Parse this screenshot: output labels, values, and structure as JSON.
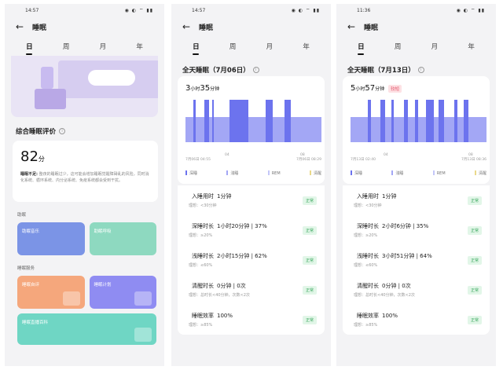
{
  "colors": {
    "deep": "#6c73ee",
    "light": "#a3a7f5",
    "rem": "#c4c7f8",
    "awake": "#ead98a",
    "normal": "#3aa75e"
  },
  "phone1": {
    "time": "14:57",
    "title": "睡眠",
    "tabs": [
      "日",
      "周",
      "月",
      "年"
    ],
    "section_title": "综合睡眠评价",
    "score": "82",
    "score_unit": "分",
    "score_label": "睡眠不足:",
    "score_desc": "整夜的睡眠过少，这可能会增加睡眠觉醒障碍乱的风险，同时消化系统、循环系统、内分泌系统、免疫系统都会受到干扰。",
    "group1_label": "助眠",
    "tile_music": "助眠音乐",
    "tile_breath": "助眠呼吸",
    "group2_label": "睡眠服务",
    "tile_quiz": "睡眠自评",
    "tile_plan": "睡眠计划",
    "tile_knowledge": "睡眠直播百科"
  },
  "phone2": {
    "time": "14:57",
    "title": "睡眠",
    "tabs": [
      "日",
      "周",
      "月",
      "年"
    ],
    "day_title": "全天睡眠（7月06日）",
    "dur_h": "3",
    "dur_h_unit": "小时",
    "dur_m": "35",
    "dur_m_unit": "分钟",
    "start": "7月06日 04:55",
    "end": "7月06日 08:29",
    "tick1": "04",
    "tick2": "08",
    "legend": [
      "深睡",
      "浅睡",
      "REM",
      "清醒"
    ],
    "metrics": [
      {
        "name": "入睡用时",
        "value": "1分钟",
        "ref": "理想：<30分钟",
        "status": "正常"
      },
      {
        "name": "深睡时长",
        "value": "1小时20分钟 | 37%",
        "ref": "理想：≥20%",
        "status": "正常"
      },
      {
        "name": "浅睡时长",
        "value": "2小时15分钟 | 62%",
        "ref": "理想：≤60%",
        "status": "正常"
      },
      {
        "name": "清醒时长",
        "value": "0分钟 | 0次",
        "ref": "理想：总时长<40分钟，次数<2次",
        "status": "正常"
      },
      {
        "name": "睡眠效率",
        "value": "100%",
        "ref": "理想：≥85%",
        "status": "正常"
      }
    ]
  },
  "phone3": {
    "time": "11:36",
    "title": "睡眠",
    "tabs": [
      "日",
      "周",
      "月",
      "年"
    ],
    "day_title": "全天睡眠（7月13日）",
    "dur_h": "5",
    "dur_h_unit": "小时",
    "dur_m": "57",
    "dur_m_unit": "分钟",
    "tag": "较短",
    "start": "7月13日 02:40",
    "end": "7月13日 08:36",
    "tick1": "04",
    "tick2": "08",
    "legend": [
      "深睡",
      "浅睡",
      "REM",
      "清醒"
    ],
    "metrics": [
      {
        "name": "入睡用时",
        "value": "1分钟",
        "ref": "理想：<30分钟",
        "status": "正常"
      },
      {
        "name": "深睡时长",
        "value": "2小时6分钟 | 35%",
        "ref": "理想：≥20%",
        "status": "正常"
      },
      {
        "name": "浅睡时长",
        "value": "3小时51分钟 | 64%",
        "ref": "理想：≤60%",
        "status": "正常"
      },
      {
        "name": "清醒时长",
        "value": "0分钟 | 0次",
        "ref": "理想：总时长<40分钟，次数<2次",
        "status": "正常"
      },
      {
        "name": "睡眠效率",
        "value": "100%",
        "ref": "理想：≥85%",
        "status": "正常"
      }
    ]
  }
}
